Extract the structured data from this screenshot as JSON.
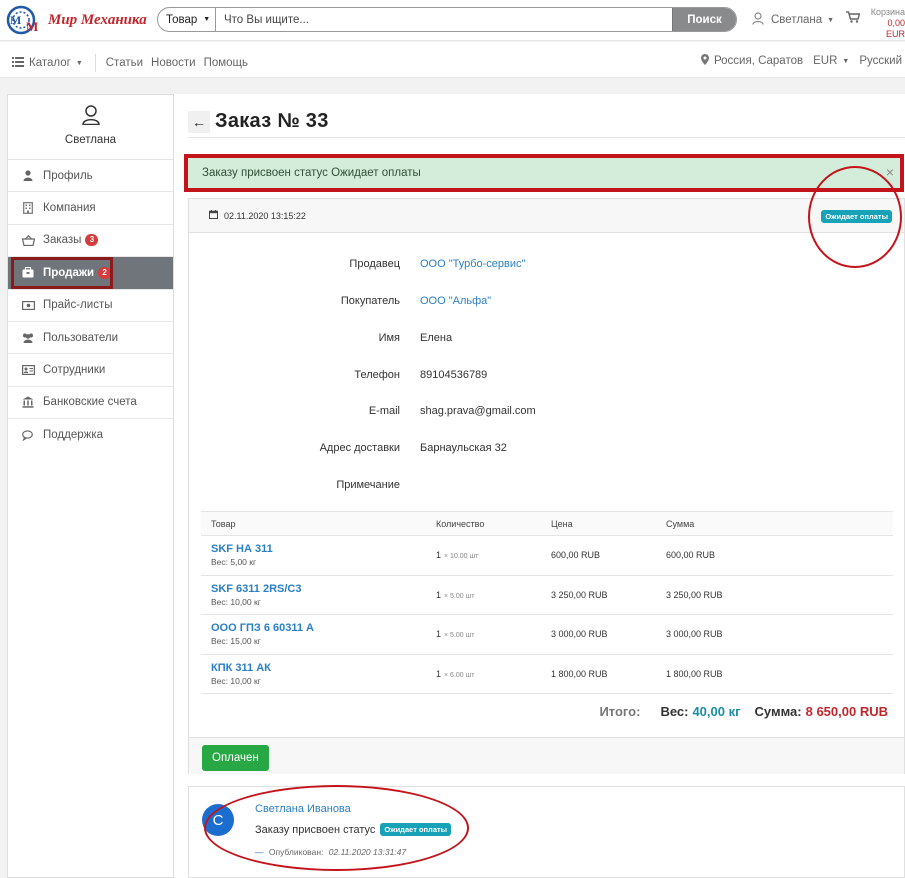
{
  "header": {
    "logo_text": "Мир Механика",
    "logo_mark_letters": [
      "M",
      "M"
    ],
    "search": {
      "category": "Товар",
      "placeholder": "Что Вы ищите...",
      "button": "Поиск"
    },
    "user_name": "Светлана",
    "cart_label": "Корзина",
    "cart_amount": "0,00 EUR"
  },
  "nav": {
    "catalog": "Каталог",
    "links": [
      "Статьи",
      "Новости",
      "Помощь"
    ],
    "location": "Россия, Саратов",
    "currency": "EUR",
    "language": "Русский"
  },
  "sidebar": {
    "user_name": "Светлана",
    "items": [
      {
        "label": "Профиль",
        "icon": "user-icon"
      },
      {
        "label": "Компания",
        "icon": "building-icon"
      },
      {
        "label": "Заказы",
        "icon": "basket-icon",
        "badge": "3"
      },
      {
        "label": "Продажи",
        "icon": "briefcase-icon",
        "badge": "2",
        "active": true
      },
      {
        "label": "Прайс-листы",
        "icon": "money-icon"
      },
      {
        "label": "Пользователи",
        "icon": "users-icon"
      },
      {
        "label": "Сотрудники",
        "icon": "id-card-icon"
      },
      {
        "label": "Банковские счета",
        "icon": "bank-icon"
      },
      {
        "label": "Поддержка",
        "icon": "chat-icon"
      }
    ]
  },
  "page": {
    "back": "←",
    "title": "Заказ № 33",
    "alert": "Заказу присвоен статус Ожидает оплаты",
    "alert_close": "×"
  },
  "order": {
    "date": "02.11.2020 13:15:22",
    "status": "Ожидает оплаты",
    "fields": [
      {
        "label": "Продавец",
        "value": "ООО \"Турбо-сервис\"",
        "link": true
      },
      {
        "label": "Покупатель",
        "value": "ООО \"Альфа\"",
        "link": true
      },
      {
        "label": "Имя",
        "value": "Елена"
      },
      {
        "label": "Телефон",
        "value": "89104536789"
      },
      {
        "label": "E-mail",
        "value": "shag.prava@gmail.com"
      },
      {
        "label": "Адрес доставки",
        "value": "Барнаульская 32"
      },
      {
        "label": "Примечание",
        "value": ""
      }
    ],
    "table": {
      "headers": [
        "Товар",
        "Количество",
        "Цена",
        "Сумма"
      ],
      "rows": [
        {
          "name": "SKF НА 311",
          "weight": "Вес: 5,00 кг",
          "qty": "1",
          "qty_sub": "× 10.00 шт",
          "price": "600,00 RUB",
          "sum": "600,00 RUB"
        },
        {
          "name": "SKF 6311 2RS/C3",
          "weight": "Вес: 10,00 кг",
          "qty": "1",
          "qty_sub": "× 5.00 шт",
          "price": "3 250,00 RUB",
          "sum": "3 250,00 RUB"
        },
        {
          "name": "ООО ГПЗ 6 60311 А",
          "weight": "Вес: 15,00 кг",
          "qty": "1",
          "qty_sub": "× 5.00 шт",
          "price": "3 000,00 RUB",
          "sum": "3 000,00 RUB"
        },
        {
          "name": "КПК 311 АК",
          "weight": "Вес: 10,00 кг",
          "qty": "1",
          "qty_sub": "× 6.00 шт",
          "price": "1 800,00 RUB",
          "sum": "1 800,00 RUB"
        }
      ]
    },
    "totals": {
      "label": "Итого:",
      "weight_label": "Вес:",
      "weight_value": "40,00 кг",
      "sum_label": "Сумма:",
      "sum_value": "8 650,00 RUB"
    },
    "paid_button": "Оплачен"
  },
  "comment": {
    "avatar_letter": "С",
    "author": "Светлана Иванова",
    "text": "Заказу присвоен статус",
    "status": "Ожидает оплаты",
    "dash": "—",
    "published_label": "Опубликован:",
    "published_date": "02.11.2020 13:31:47"
  },
  "colors": {
    "brand_red": "#c0272d",
    "link_blue": "#2a7fc6",
    "teal_badge": "#17a2b8",
    "success_green": "#28a745",
    "annotation_red": "#c3141b"
  }
}
